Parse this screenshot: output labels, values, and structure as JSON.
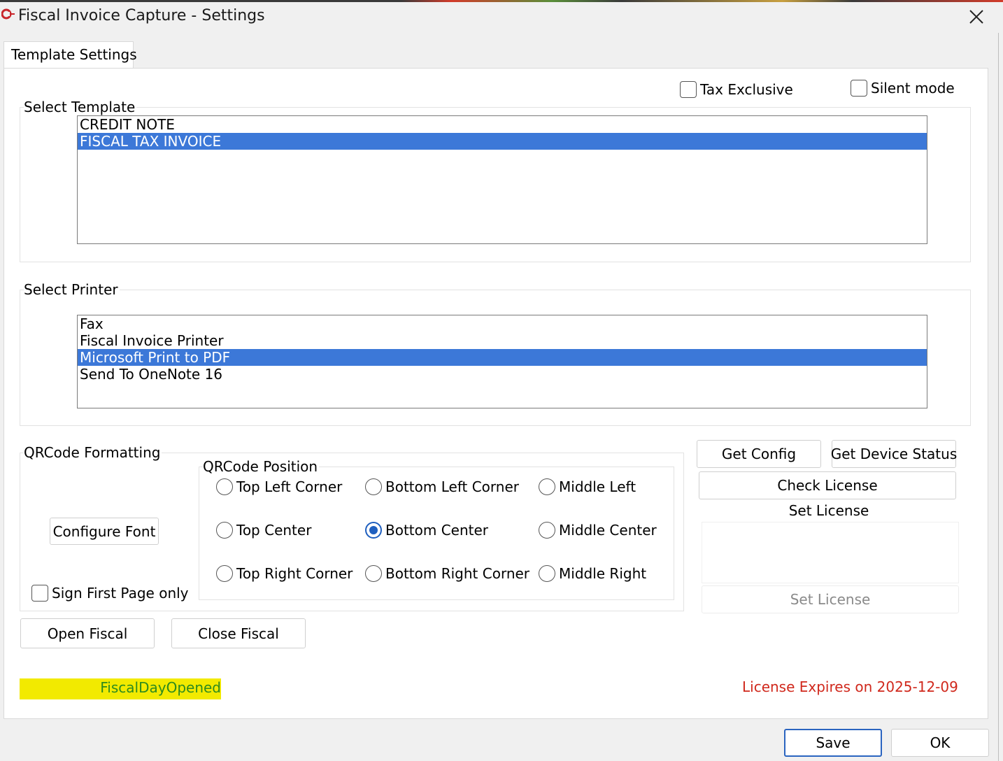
{
  "window": {
    "title": "Fiscal Invoice Capture - Settings"
  },
  "tabs": [
    {
      "label": "Template Settings",
      "active": true
    }
  ],
  "options": {
    "tax_exclusive": {
      "label": "Tax Exclusive",
      "checked": false
    },
    "silent_mode": {
      "label": "Silent mode",
      "checked": false
    }
  },
  "template": {
    "group_label": "Select Template",
    "items": [
      "CREDIT NOTE",
      "FISCAL TAX INVOICE"
    ],
    "selected": "FISCAL TAX INVOICE"
  },
  "printer": {
    "group_label": "Select Printer",
    "items": [
      "Fax",
      "Fiscal Invoice Printer",
      "Microsoft Print to PDF",
      "Send To OneNote 16"
    ],
    "selected": "Microsoft Print to PDF"
  },
  "qrcode": {
    "group_label": "QRCode Formatting",
    "configure_font": "Configure Font",
    "sign_first_page": {
      "label": "Sign First Page only",
      "checked": false
    },
    "position": {
      "group_label": "QRCode Position",
      "options": [
        "Top Left Corner",
        "Bottom Left Corner",
        "Middle Left",
        "Top Center",
        "Bottom Center",
        "Middle Center",
        "Top Right Corner",
        "Bottom Right Corner",
        "Middle Right"
      ],
      "selected": "Bottom Center"
    }
  },
  "device": {
    "get_config": "Get Config",
    "get_device_status": "Get Device Status",
    "check_license": "Check License",
    "set_license_label": "Set License",
    "set_license_button": "Set License"
  },
  "fiscal": {
    "open": "Open Fiscal",
    "close": "Close Fiscal",
    "status": "FiscalDayOpened"
  },
  "license": {
    "expiry": "License Expires on 2025-12-09"
  },
  "footer": {
    "save": "Save",
    "ok": "OK"
  },
  "colors": {
    "selection": "#3c78d8",
    "status_text": "#2e8b1e",
    "status_highlight": "#f2ea00",
    "license_text": "#d0281c",
    "radio_accent": "#1f5fbf"
  },
  "icons": {
    "app": "app-logo-icon",
    "close": "close-icon"
  }
}
